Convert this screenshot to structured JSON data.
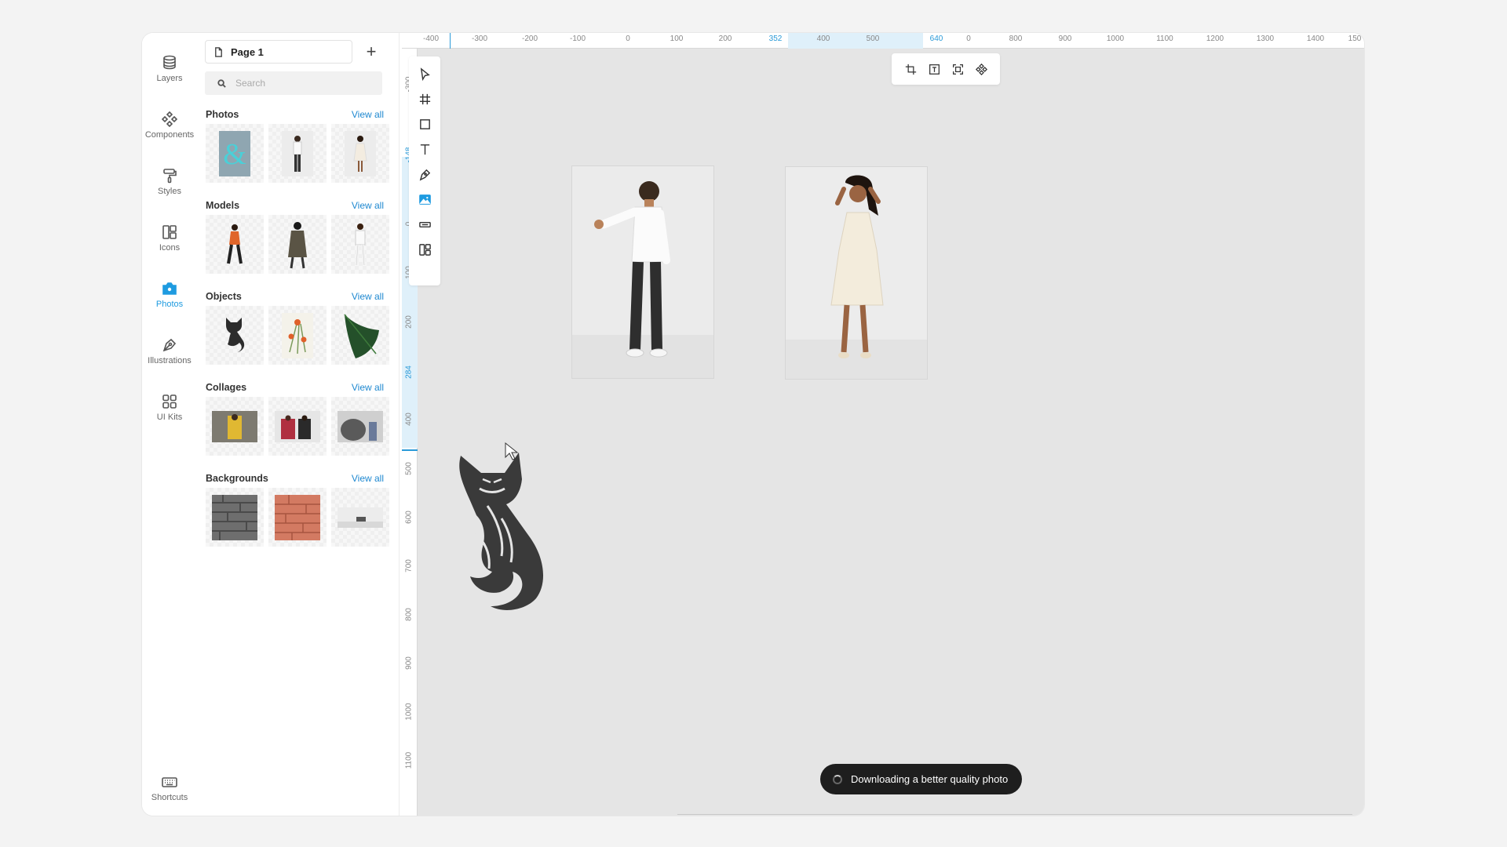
{
  "rail": {
    "layers": "Layers",
    "components": "Components",
    "styles": "Styles",
    "icons": "Icons",
    "photos": "Photos",
    "illustrations": "Illustrations",
    "ui_kits": "UI Kits",
    "shortcuts": "Shortcuts"
  },
  "panel": {
    "page_name": "Page 1",
    "add_page": "+",
    "search_placeholder": "Search",
    "view_all": "View all",
    "sections": {
      "photos": "Photos",
      "models": "Models",
      "objects": "Objects",
      "collages": "Collages",
      "backgrounds": "Backgrounds"
    }
  },
  "ruler_top": [
    "-400",
    "-300",
    "-200",
    "-100",
    "0",
    "100",
    "200",
    "352",
    "400",
    "500",
    "640",
    "0",
    "800",
    "900",
    "1000",
    "1100",
    "1200",
    "1300",
    "1400",
    "150"
  ],
  "ruler_left": [
    "-300",
    "-148",
    "0",
    "100",
    "200",
    "284",
    "400",
    "500",
    "600",
    "700",
    "800",
    "900",
    "1000",
    "1100"
  ],
  "toast": "Downloading a better quality photo",
  "colors": {
    "accent": "#1e9be0",
    "canvas": "#e5e5e5",
    "toast_bg": "#1e1e1e"
  }
}
